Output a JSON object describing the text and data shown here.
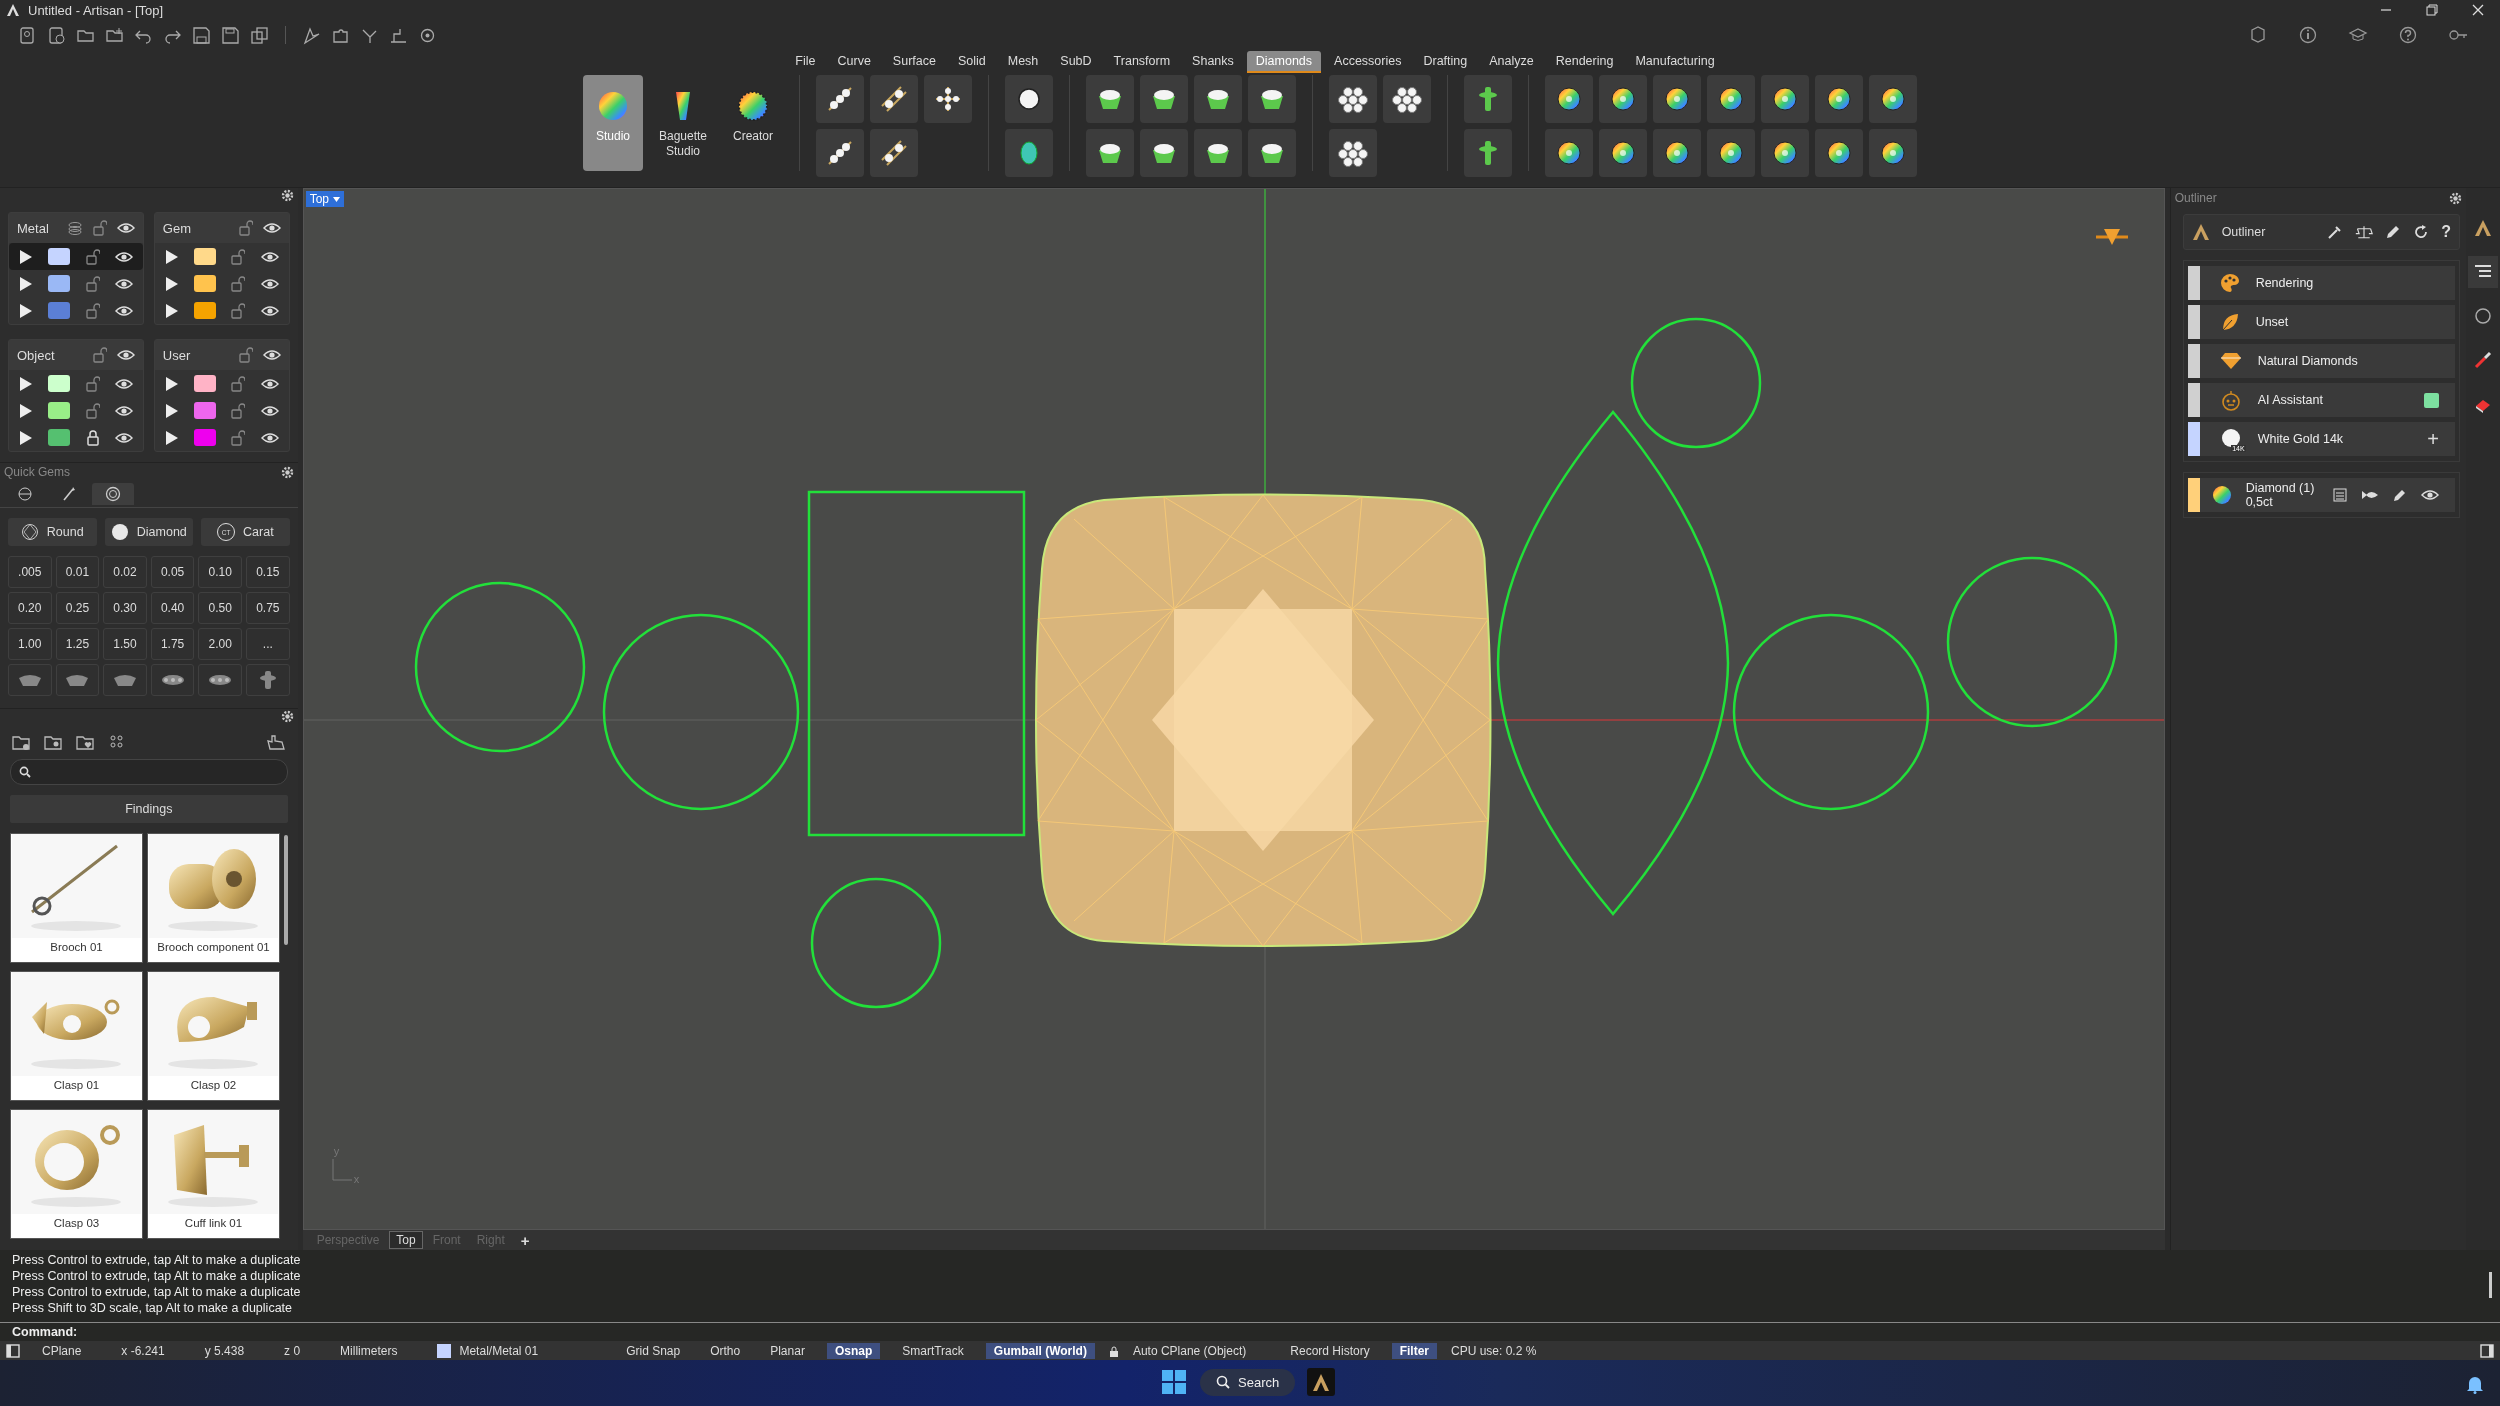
{
  "window": {
    "title": "Untitled - Artisan - [Top]"
  },
  "menu_tabs": [
    {
      "label": "File",
      "selected": false
    },
    {
      "label": "Curve",
      "selected": false
    },
    {
      "label": "Surface",
      "selected": false
    },
    {
      "label": "Solid",
      "selected": false
    },
    {
      "label": "Mesh",
      "selected": false
    },
    {
      "label": "SubD",
      "selected": false
    },
    {
      "label": "Transform",
      "selected": false
    },
    {
      "label": "Shanks",
      "selected": false
    },
    {
      "label": "Diamonds",
      "selected": true
    },
    {
      "label": "Accessories",
      "selected": false
    },
    {
      "label": "Drafting",
      "selected": false
    },
    {
      "label": "Analyze",
      "selected": false
    },
    {
      "label": "Rendering",
      "selected": false
    },
    {
      "label": "Manufacturing",
      "selected": false
    }
  ],
  "ribbon_buttons": [
    {
      "label": "Studio",
      "kind": "wheel",
      "selected": true
    },
    {
      "label": "Baguette Studio",
      "kind": "baguette",
      "selected": false
    },
    {
      "label": "Creator",
      "kind": "dotted",
      "selected": false
    }
  ],
  "layer_groups": [
    {
      "title": "Metal",
      "layers": [
        {
          "color": "#c5d4ff",
          "locked": false,
          "selected": true
        },
        {
          "color": "#9ab8f5",
          "locked": false,
          "selected": false
        },
        {
          "color": "#5b7fd6",
          "locked": false,
          "selected": false
        }
      ]
    },
    {
      "title": "Gem",
      "layers": [
        {
          "color": "#ffd98a",
          "locked": false,
          "selected": false
        },
        {
          "color": "#ffc34d",
          "locked": false,
          "selected": false
        },
        {
          "color": "#f5a300",
          "locked": false,
          "selected": false
        }
      ]
    },
    {
      "title": "Object",
      "layers": [
        {
          "color": "#ccffcc",
          "locked": false,
          "selected": false
        },
        {
          "color": "#99ee88",
          "locked": false,
          "selected": false
        },
        {
          "color": "#55c070",
          "locked": true,
          "selected": false
        }
      ]
    },
    {
      "title": "User",
      "layers": [
        {
          "color": "#ffb3c6",
          "locked": false,
          "selected": false
        },
        {
          "color": "#ee66ee",
          "locked": false,
          "selected": false
        },
        {
          "color": "#ee00ee",
          "locked": false,
          "selected": false
        }
      ]
    }
  ],
  "quick_gems": {
    "title": "Quick Gems",
    "tabs": [
      {
        "selected": false
      },
      {
        "selected": false
      },
      {
        "selected": true
      }
    ],
    "dropdowns": [
      {
        "label": "Round",
        "kind": "round"
      },
      {
        "label": "Diamond",
        "kind": "diamond"
      },
      {
        "label": "Carat",
        "kind": "carat",
        "icon_text": "CT"
      }
    ],
    "sizes": [
      ".005",
      "0.01",
      "0.02",
      "0.05",
      "0.10",
      "0.15",
      "0.20",
      "0.25",
      "0.30",
      "0.40",
      "0.50",
      "0.75",
      "1.00",
      "1.25",
      "1.50",
      "1.75",
      "2.00",
      "..."
    ]
  },
  "library": {
    "category": "Findings",
    "items": [
      {
        "label": "Brooch 01",
        "kind": "picture"
      },
      {
        "label": "Brooch component 01",
        "kind": "picture"
      },
      {
        "label": "Clasp 01",
        "kind": "picture"
      },
      {
        "label": "Clasp 02",
        "kind": "picture"
      },
      {
        "label": "Clasp 03",
        "kind": "picture"
      },
      {
        "label": "Cuff link 01",
        "kind": "picture"
      }
    ]
  },
  "viewport": {
    "label": "Top",
    "axis_labels": [
      "y",
      "x"
    ],
    "tabs": [
      {
        "label": "Perspective",
        "selected": false
      },
      {
        "label": "Top",
        "selected": true
      },
      {
        "label": "Front",
        "selected": false
      },
      {
        "label": "Right",
        "selected": false
      }
    ],
    "add_tab": "+"
  },
  "outliner": {
    "title": "Outliner",
    "header": "Outliner",
    "help": "?",
    "items": [
      {
        "label": "Rendering",
        "kind": "palette",
        "color": "#d0d0d0"
      },
      {
        "label": "Unset",
        "kind": "leaf",
        "color": "#d0d0d0"
      },
      {
        "label": "Natural Diamonds",
        "kind": "gem",
        "color": "#d0d0d0"
      },
      {
        "label": "AI Assistant",
        "kind": "assistant",
        "color": "#d0d0d0"
      },
      {
        "label": "White Gold 14k",
        "kind": "material",
        "color": "#c5d4ff",
        "icon_text": "14K",
        "action": "+"
      }
    ],
    "selection": {
      "label": "Diamond (1) 0,5ct",
      "color": "#ffd07a"
    },
    "side_tabs": [
      {
        "selected": false
      },
      {
        "selected": true
      },
      {
        "selected": false
      },
      {
        "selected": false
      },
      {
        "selected": false
      }
    ]
  },
  "command_history": [
    "Press Control to extrude, tap Alt to make a duplicate",
    "Press Control to extrude, tap Alt to make a duplicate",
    "Press Control to extrude, tap Alt to make a duplicate",
    "Press Shift to 3D scale, tap Alt to make a duplicate"
  ],
  "command_prompt": "Command:",
  "status_bar": {
    "items": [
      {
        "kind": "text",
        "label": "CPlane"
      },
      {
        "kind": "text",
        "label": "x -6.241"
      },
      {
        "kind": "text",
        "label": "y 5.438"
      },
      {
        "kind": "text",
        "label": "z 0"
      },
      {
        "kind": "text",
        "label": "Millimeters"
      },
      {
        "kind": "layer",
        "label": "Metal/Metal 01",
        "color": "#c5d4ff"
      }
    ],
    "toggles": [
      {
        "label": "Grid Snap",
        "on": false
      },
      {
        "label": "Ortho",
        "on": false
      },
      {
        "label": "Planar",
        "on": false
      },
      {
        "label": "Osnap",
        "on": true
      },
      {
        "label": "SmartTrack",
        "on": false
      },
      {
        "label": "Gumball (World)",
        "on": true
      },
      {
        "label": "Auto CPlane (Object)",
        "on": false,
        "kind": "lock"
      },
      {
        "label": "Record History",
        "on": false
      },
      {
        "label": "Filter",
        "on": true
      }
    ],
    "cpu": "CPU use: 0.2 %"
  },
  "taskbar": {
    "search": "Search"
  }
}
